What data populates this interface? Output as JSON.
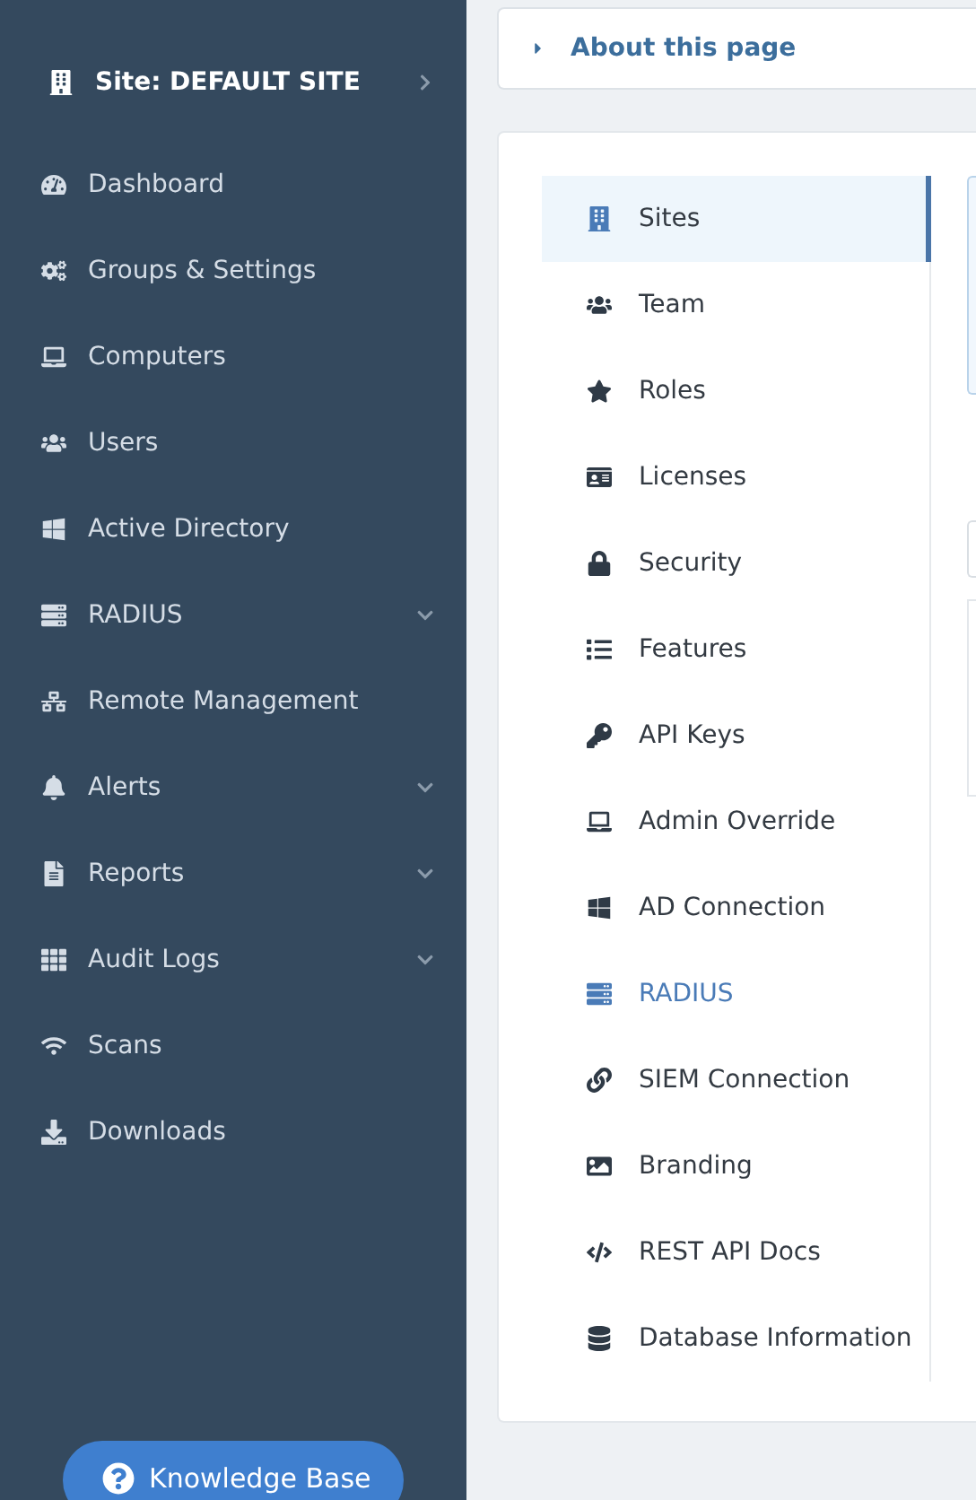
{
  "sidebar": {
    "site": {
      "label": "Site: DEFAULT SITE"
    },
    "items": [
      {
        "label": "Dashboard",
        "expandable": false
      },
      {
        "label": "Groups & Settings",
        "expandable": false
      },
      {
        "label": "Computers",
        "expandable": false
      },
      {
        "label": "Users",
        "expandable": false
      },
      {
        "label": "Active Directory",
        "expandable": false
      },
      {
        "label": "RADIUS",
        "expandable": true
      },
      {
        "label": "Remote Management",
        "expandable": false
      },
      {
        "label": "Alerts",
        "expandable": true
      },
      {
        "label": "Reports",
        "expandable": true
      },
      {
        "label": "Audit Logs",
        "expandable": true
      },
      {
        "label": "Scans",
        "expandable": false
      },
      {
        "label": "Downloads",
        "expandable": false
      }
    ],
    "help_button": {
      "label": "Knowledge Base"
    }
  },
  "about": {
    "label": "About this page",
    "expanded": false
  },
  "settings_nav": {
    "items": [
      {
        "label": "Sites",
        "selected": true,
        "highlighted": false
      },
      {
        "label": "Team",
        "selected": false,
        "highlighted": false
      },
      {
        "label": "Roles",
        "selected": false,
        "highlighted": false
      },
      {
        "label": "Licenses",
        "selected": false,
        "highlighted": false
      },
      {
        "label": "Security",
        "selected": false,
        "highlighted": false
      },
      {
        "label": "Features",
        "selected": false,
        "highlighted": false
      },
      {
        "label": "API Keys",
        "selected": false,
        "highlighted": false
      },
      {
        "label": "Admin Override",
        "selected": false,
        "highlighted": false
      },
      {
        "label": "AD Connection",
        "selected": false,
        "highlighted": false
      },
      {
        "label": "RADIUS",
        "selected": false,
        "highlighted": true
      },
      {
        "label": "SIEM Connection",
        "selected": false,
        "highlighted": false
      },
      {
        "label": "Branding",
        "selected": false,
        "highlighted": false
      },
      {
        "label": "REST API Docs",
        "selected": false,
        "highlighted": false
      },
      {
        "label": "Database Information",
        "selected": false,
        "highlighted": false
      }
    ]
  }
}
